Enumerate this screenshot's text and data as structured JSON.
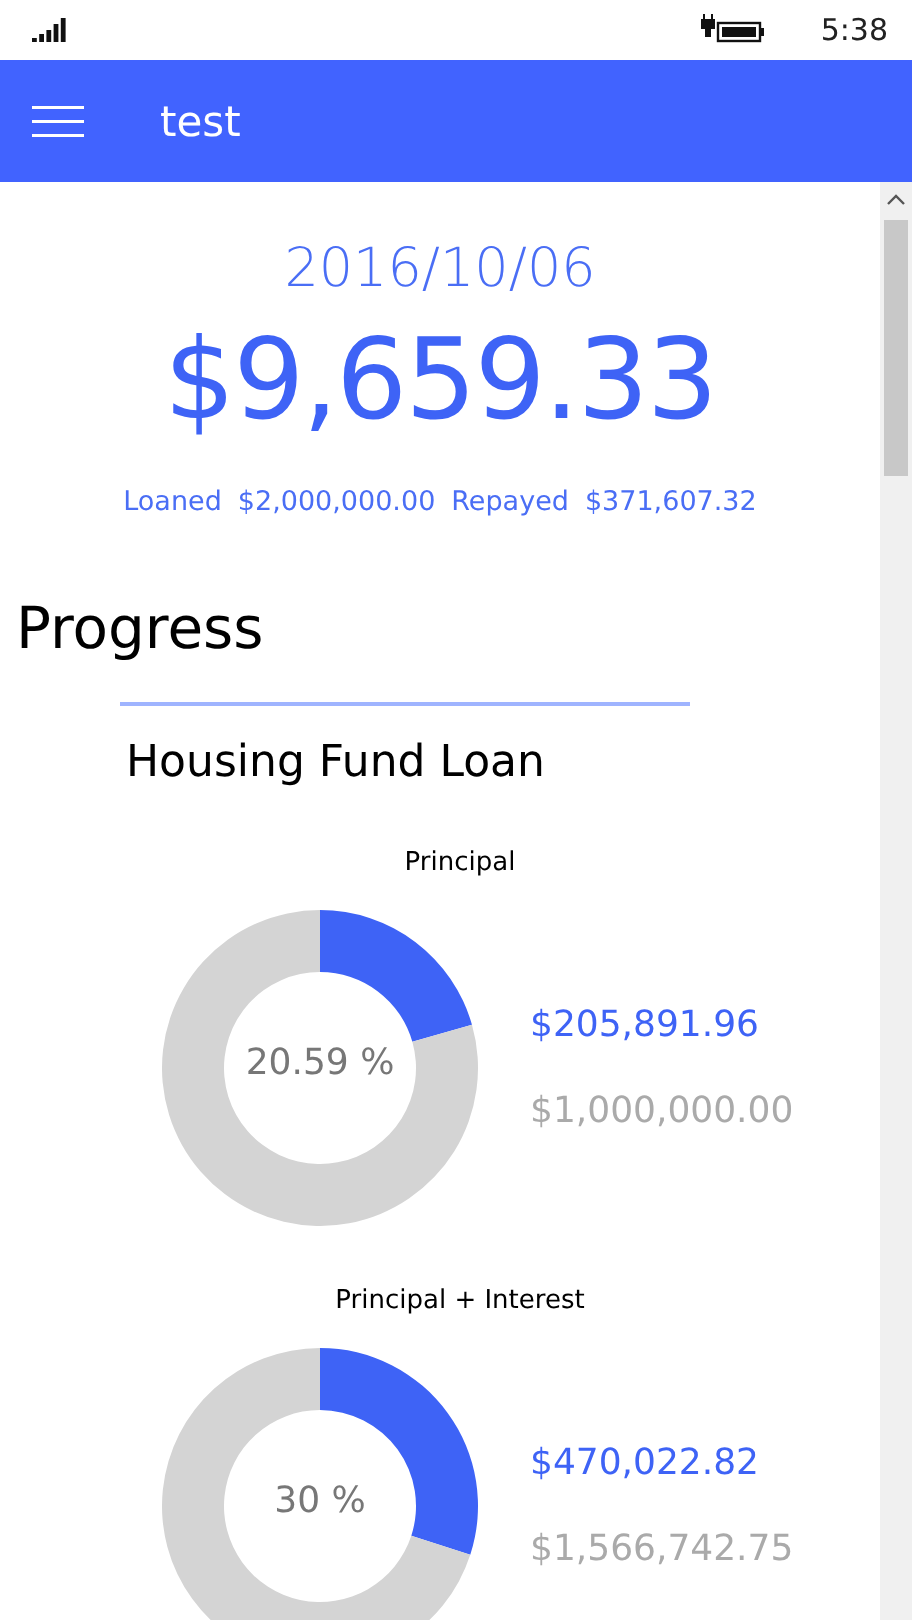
{
  "status_bar": {
    "time": "5:38"
  },
  "app_bar": {
    "title": "test"
  },
  "summary": {
    "date": "2016/10/06",
    "amount": "$9,659.33",
    "loaned_label": "Loaned",
    "loaned": "$2,000,000.00",
    "repayed_label": "Repayed",
    "repayed": "$371,607.32"
  },
  "section": {
    "title": "Progress"
  },
  "loan": {
    "title": "Housing Fund Loan",
    "items": [
      {
        "label": "Principal",
        "chart_data": {
          "type": "donut",
          "values": [
            20.59,
            79.41
          ]
        },
        "percent": "20.59 %",
        "paid": "$205,891.96",
        "total": "$1,000,000.00"
      },
      {
        "label": "Principal + Interest",
        "chart_data": {
          "type": "donut",
          "values": [
            30,
            70
          ]
        },
        "percent": "30 %",
        "paid": "$470,022.82",
        "total": "$1,566,742.75"
      }
    ]
  }
}
